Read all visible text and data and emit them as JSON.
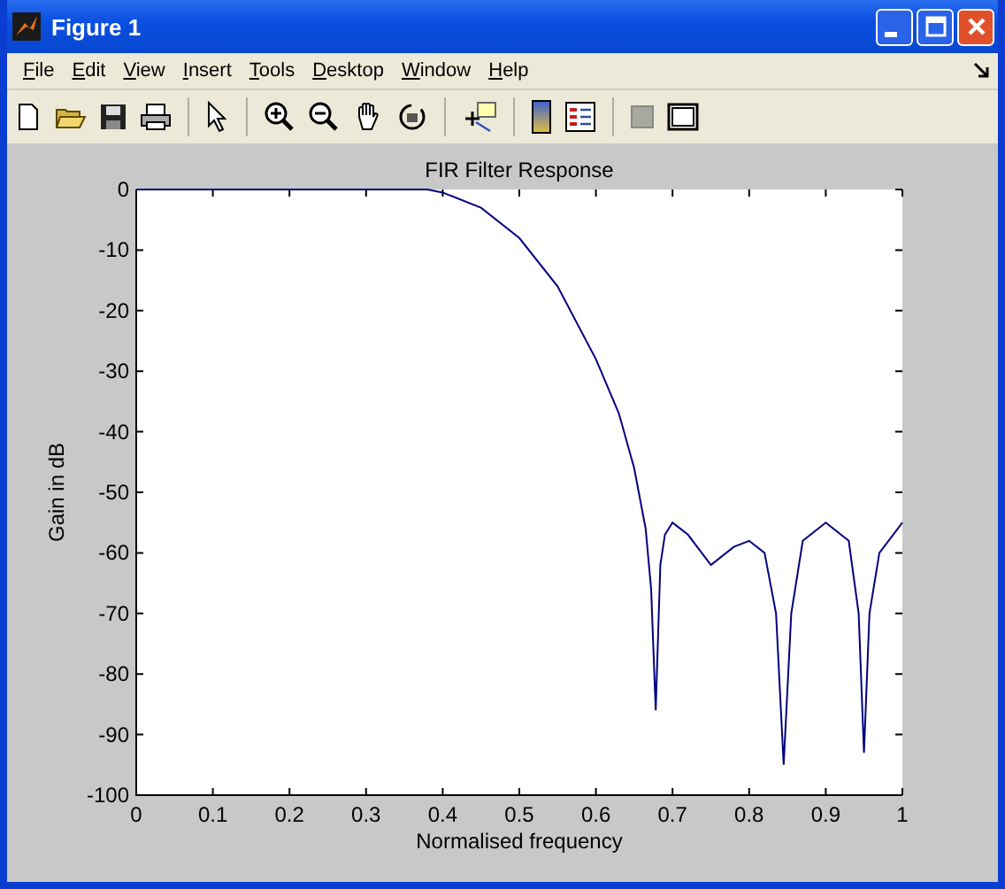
{
  "window": {
    "title": "Figure 1"
  },
  "menu": [
    "File",
    "Edit",
    "View",
    "Insert",
    "Tools",
    "Desktop",
    "Window",
    "Help"
  ],
  "figure": {
    "chart_data": {
      "type": "line",
      "title": "FIR Filter Response",
      "xlabel": "Normalised frequency",
      "ylabel": "Gain in dB",
      "x": [
        0,
        0.38,
        0.4,
        0.45,
        0.5,
        0.55,
        0.6,
        0.63,
        0.65,
        0.665,
        0.672,
        0.678,
        0.684,
        0.69,
        0.7,
        0.72,
        0.75,
        0.78,
        0.8,
        0.82,
        0.835,
        0.845,
        0.855,
        0.87,
        0.9,
        0.93,
        0.943,
        0.95,
        0.957,
        0.97,
        1
      ],
      "series": [
        {
          "color": "#00007f",
          "values": [
            0,
            0,
            -0.5,
            -3,
            -8,
            -16,
            -28,
            -37,
            -46,
            -56,
            -66,
            -86,
            -62,
            -57,
            -55,
            -57,
            -62,
            -59,
            -58,
            -60,
            -70,
            -95,
            -70,
            -58,
            -55,
            -58,
            -70,
            -93,
            -70,
            -60,
            -55
          ]
        }
      ],
      "xlim": [
        0,
        1
      ],
      "ylim": [
        -100,
        0
      ],
      "xticks": [
        0,
        0.1,
        0.2,
        0.3,
        0.4,
        0.5,
        0.6,
        0.7,
        0.8,
        0.9,
        1
      ],
      "yticks": [
        0,
        -10,
        -20,
        -30,
        -40,
        -50,
        -60,
        -70,
        -80,
        -90,
        -100
      ]
    }
  }
}
